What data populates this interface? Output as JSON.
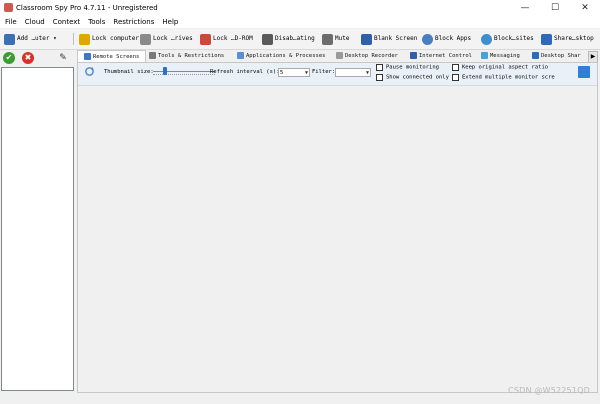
{
  "window": {
    "title": "Classroom Spy Pro 4.7.11 - Unregistered",
    "minimize_glyph": "—",
    "maximize_glyph": "☐",
    "close_glyph": "✕"
  },
  "menu": [
    "File",
    "Cloud",
    "Context",
    "Tools",
    "Restrictions",
    "Help"
  ],
  "toolbar": {
    "add_computer": "Add …uter",
    "add_dropdown": "▾",
    "lock_computer": "Lock computer",
    "lock_drives": "Lock …rives",
    "lock_cdrom": "Lock …D-ROM",
    "disable_sharing": "Disab…ating",
    "mute": "Mute",
    "blank_screen": "Blank Screen",
    "block_apps": "Block Apps",
    "block_sites": "Block…sites",
    "share_desktop": "Share…sktop"
  },
  "left_pane": {
    "ok_glyph": "✔",
    "cancel_glyph": "✖",
    "edit_glyph": "✎"
  },
  "tabs": [
    {
      "label": "Remote Screens",
      "active": true
    },
    {
      "label": "Tools & Restrictions",
      "active": false
    },
    {
      "label": "Applications & Processes",
      "active": false
    },
    {
      "label": "Desktop Recorder",
      "active": false
    },
    {
      "label": "Internet Control",
      "active": false
    },
    {
      "label": "Messaging",
      "active": false
    },
    {
      "label": "Desktop Shar",
      "active": false
    }
  ],
  "tab_scroll_glyph": "▶",
  "options": {
    "thumbnail_size_label": "Thumbnail size:",
    "thumbnail_size_value": 0.2,
    "refresh_interval_label": "Refresh interval (s):",
    "refresh_interval_value": "5",
    "filter_label": "Filter:",
    "filter_value": "",
    "pause_monitoring": "Pause monitoring",
    "show_connected_only": "Show connected only",
    "keep_aspect_ratio": "Keep original aspect ratio",
    "extend_multiple_monitor": "Extend multiple monitor scre"
  },
  "watermark": "CSDN @W52251QD",
  "colors": {
    "accent": "#2a6fc9",
    "ok": "#3a9c33",
    "cancel": "#d9302a"
  }
}
